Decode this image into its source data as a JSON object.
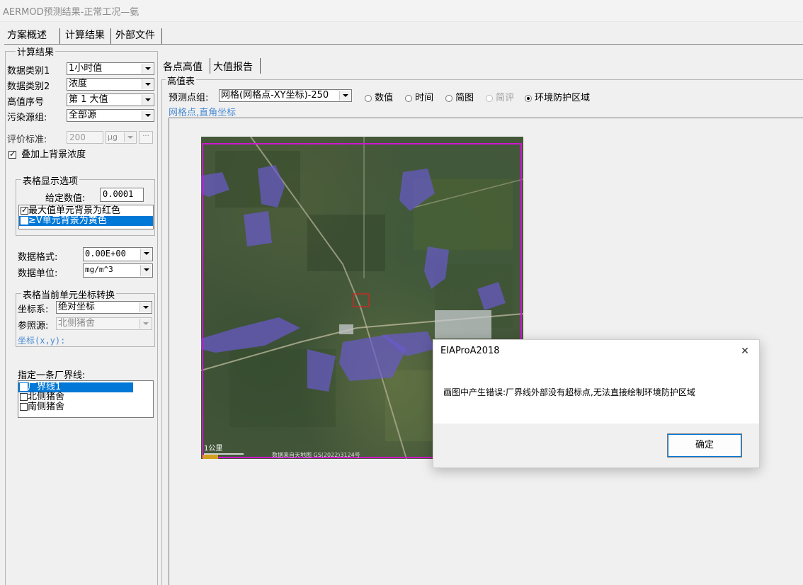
{
  "window": {
    "title": "AERMOD预测结果-正常工况—氨"
  },
  "top_tabs": [
    "方案概述",
    "计算结果",
    "外部文件"
  ],
  "result_group": {
    "title": "计算结果",
    "data_type1": {
      "label": "数据类别1",
      "value": "1小时值"
    },
    "data_type2": {
      "label": "数据类别2",
      "value": "浓度"
    },
    "high_order": {
      "label": "高值序号",
      "value": "第 1 大值"
    },
    "source_group": {
      "label": "污染源组:",
      "value": "全部源"
    },
    "eval_std": {
      "label": "评价标准:",
      "value": "200",
      "unit": "μg",
      "more": "···"
    },
    "add_background": {
      "label": "叠加上背景浓度",
      "checked": true
    }
  },
  "table_options": {
    "title": "表格显示选项",
    "given_value_label": "给定数值:",
    "given_value": "0.0001",
    "items": [
      {
        "label": "最大值单元背景为红色",
        "checked": true,
        "selected": false
      },
      {
        "label": "≥V单元背景为黄色",
        "checked": true,
        "selected": true
      }
    ],
    "format_label": "数据格式:",
    "format_value": "0.00E+00",
    "unit_label": "数据单位:",
    "unit_value": "mg/m^3"
  },
  "coord_convert": {
    "title": "表格当前单元坐标转换",
    "system_label": "坐标系:",
    "system_value": "绝对坐标",
    "ref_label": "参照源:",
    "ref_value": "北侧猪舍",
    "coord_label": "坐标(x,y):"
  },
  "boundary": {
    "title": "指定一条厂界线:",
    "items": [
      {
        "label": "厂界线1",
        "checked": true,
        "selected": true
      },
      {
        "label": "北侧猪舍",
        "checked": false,
        "selected": false
      },
      {
        "label": "南侧猪舍",
        "checked": false,
        "selected": false
      }
    ]
  },
  "right_tabs": [
    "各点高值",
    "大值报告"
  ],
  "high_table": {
    "title": "高值表",
    "group_label": "预测点组:",
    "group_value": "网格(网格点-XY坐标)-250",
    "radios": [
      {
        "label": "数值",
        "on": false,
        "disabled": false
      },
      {
        "label": "时间",
        "on": false,
        "disabled": false
      },
      {
        "label": "简图",
        "on": false,
        "disabled": false
      },
      {
        "label": "简评",
        "on": false,
        "disabled": true
      },
      {
        "label": "环境防护区域",
        "on": true,
        "disabled": false
      }
    ],
    "grid_caption": "网格点,直角坐标"
  },
  "map": {
    "scale_label": "1公里",
    "credit": "数据来自天地图 GS(2022)3124号"
  },
  "dialog": {
    "title": "EIAProA2018",
    "close": "✕",
    "message": "画图中产生错误:厂界线外部没有超标点,无法直接绘制环境防护区域",
    "ok": "确定"
  }
}
